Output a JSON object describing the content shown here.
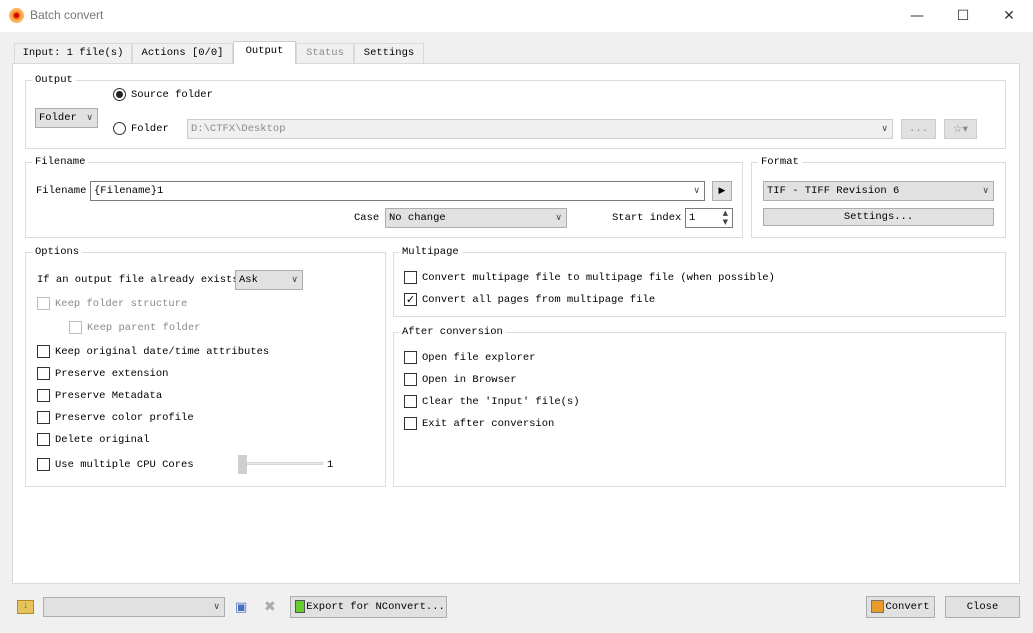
{
  "window": {
    "title": "Batch convert",
    "icon": "xnview-logo-icon"
  },
  "tabs": [
    {
      "label": "Input: 1 file(s)"
    },
    {
      "label": "Actions [0/0]"
    },
    {
      "label": "Output"
    },
    {
      "label": "Status"
    },
    {
      "label": "Settings"
    }
  ],
  "output": {
    "group": "Output",
    "mode": "Folder",
    "source_folder": "Source folder",
    "folder": "Folder",
    "folder_path": "D:\\CTFX\\Desktop",
    "browse": "...",
    "selected": "source_folder"
  },
  "filename": {
    "group": "Filename",
    "label": "Filename",
    "value": "{Filename}1",
    "case_label": "Case",
    "case_value": "No change",
    "start_label": "Start index",
    "start_value": "1"
  },
  "format": {
    "group": "Format",
    "value": "TIF - TIFF Revision 6",
    "settings": "Settings..."
  },
  "options": {
    "group": "Options",
    "exists_label": "If an output file already exists",
    "exists_value": "Ask",
    "items": [
      {
        "label": "Keep folder structure",
        "checked": false,
        "disabled": true
      },
      {
        "label": "Keep parent folder",
        "checked": false,
        "disabled": true
      },
      {
        "label": "Keep original date/time attributes",
        "checked": false
      },
      {
        "label": "Preserve extension",
        "checked": false
      },
      {
        "label": "Preserve Metadata",
        "checked": false
      },
      {
        "label": "Preserve color profile",
        "checked": false
      },
      {
        "label": "Delete original",
        "checked": false
      },
      {
        "label": "Use multiple CPU Cores",
        "checked": false
      }
    ],
    "cpu_cores": "1"
  },
  "multipage": {
    "group": "Multipage",
    "items": [
      {
        "label": "Convert multipage file to multipage file (when possible)",
        "checked": false
      },
      {
        "label": "Convert all pages from multipage file",
        "checked": true
      }
    ]
  },
  "after": {
    "group": "After conversion",
    "items": [
      {
        "label": "Open file explorer",
        "checked": false
      },
      {
        "label": "Open in Browser",
        "checked": false
      },
      {
        "label": "Clear the 'Input' file(s)",
        "checked": false
      },
      {
        "label": "Exit after conversion",
        "checked": false
      }
    ]
  },
  "footer": {
    "export": "Export for NConvert...",
    "convert": "Convert",
    "close": "Close",
    "preset_value": ""
  }
}
